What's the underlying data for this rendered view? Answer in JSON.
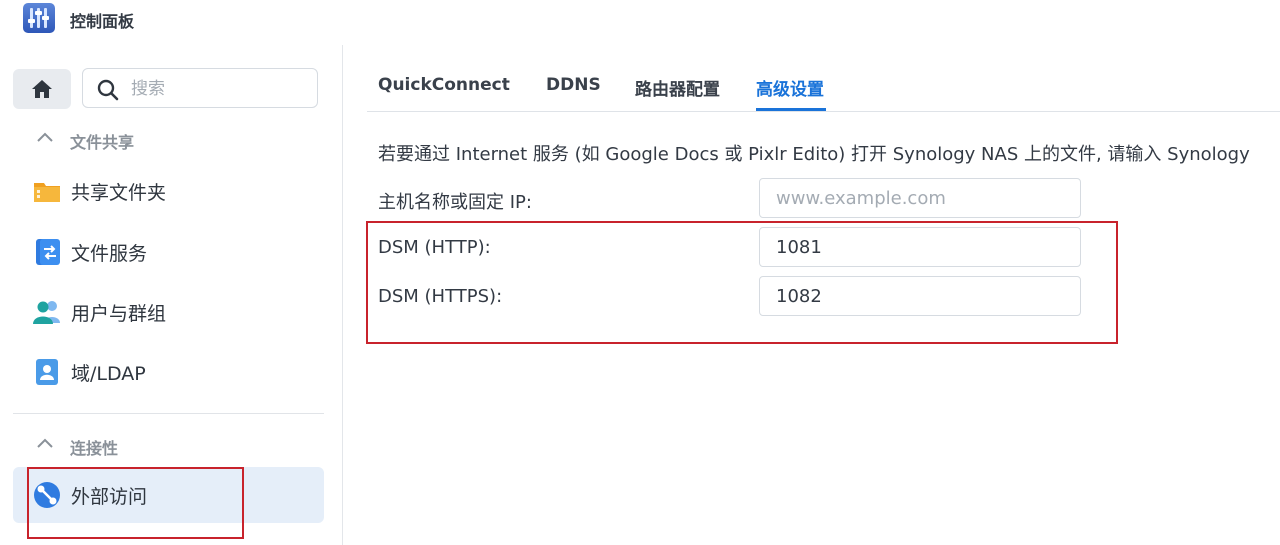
{
  "window": {
    "title": "控制面板",
    "icon": "control-panel-icon"
  },
  "sidebar": {
    "home_icon": "home-icon",
    "search": {
      "placeholder": "搜索",
      "value": "",
      "icon": "search-icon"
    },
    "sections": [
      {
        "label": "文件共享",
        "items": [
          {
            "label": "共享文件夹",
            "icon": "shared-folder-icon"
          },
          {
            "label": "文件服务",
            "icon": "file-services-icon"
          },
          {
            "label": "用户与群组",
            "icon": "user-group-icon"
          },
          {
            "label": "域/LDAP",
            "icon": "domain-ldap-icon"
          }
        ]
      },
      {
        "label": "连接性",
        "items": [
          {
            "label": "外部访问",
            "icon": "external-access-icon",
            "active": true
          }
        ]
      }
    ]
  },
  "main": {
    "tabs": [
      {
        "label": "QuickConnect"
      },
      {
        "label": "DDNS"
      },
      {
        "label": "路由器配置"
      },
      {
        "label": "高级设置",
        "active": true
      }
    ],
    "description": "若要通过 Internet 服务 (如 Google Docs 或 Pixlr Edito) 打开 Synology NAS 上的文件, 请输入 Synology",
    "fields": [
      {
        "label": "主机名称或固定 IP:",
        "value": "",
        "placeholder": "www.example.com"
      },
      {
        "label": "DSM (HTTP):",
        "value": "1081",
        "placeholder": ""
      },
      {
        "label": "DSM (HTTPS):",
        "value": "1082",
        "placeholder": ""
      }
    ]
  },
  "colors": {
    "accent": "#1a73d9",
    "highlight_box": "#c8232c",
    "active_item_bg": "#e5eef9"
  }
}
